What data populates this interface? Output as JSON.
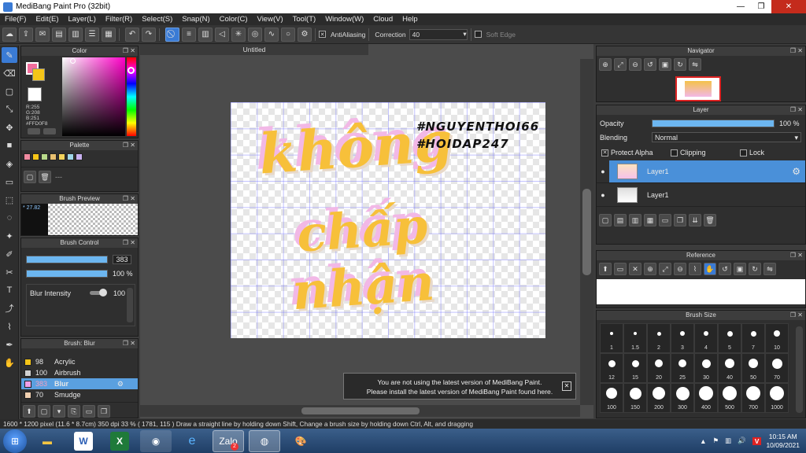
{
  "window": {
    "title": "MediBang Paint Pro (32bit)",
    "min": "—",
    "max": "❐",
    "close": "✕"
  },
  "menu": [
    "File(F)",
    "Edit(E)",
    "Layer(L)",
    "Filter(R)",
    "Select(S)",
    "Snap(N)",
    "Color(C)",
    "View(V)",
    "Tool(T)",
    "Window(W)",
    "Cloud",
    "Help"
  ],
  "toolbar": {
    "antialias_label": "AntiAliasing",
    "antialias_checked": "✕",
    "correction_label": "Correction",
    "correction_value": "40",
    "softedge_label": "Soft Edge"
  },
  "doc": {
    "tab_title": "Untitled"
  },
  "color_panel": {
    "title": "Color",
    "r": "R:255",
    "g": "G:208",
    "b": "B:251",
    "hex": "#FFD0F8",
    "fg": "#f0a0e8",
    "bg": "#f5c518"
  },
  "palette": {
    "title": "Palette",
    "swatches": [
      "#f08aa0",
      "#f5c518",
      "#b8d98a",
      "#e8c070",
      "#f2d35c",
      "#9ed6e8",
      "#c8b0f0"
    ],
    "dashes": "---"
  },
  "brush_preview": {
    "title": "Brush Preview",
    "size": "* 27.82"
  },
  "brush_control": {
    "title": "Brush Control",
    "size_value": "383",
    "opacity_value": "100 %",
    "blur_label": "Blur Intensity",
    "blur_value": "100",
    "size_fill": 1.0,
    "opacity_fill": 1.0,
    "blur_fill": 0.85
  },
  "brush_list": {
    "title": "Brush: Blur",
    "items": [
      {
        "size": "98",
        "name": "Acrylic",
        "color": "#f5c518",
        "selected": false
      },
      {
        "size": "100",
        "name": "Airbrush",
        "color": "#d0d0d0",
        "selected": false
      },
      {
        "size": "383",
        "name": "Blur",
        "color": "#f0a0e8",
        "selected": true
      },
      {
        "size": "70",
        "name": "Smudge",
        "color": "#f0d0b0",
        "selected": false
      }
    ]
  },
  "canvas": {
    "line1": "không",
    "line2": "chấp",
    "line3": "nhận",
    "tag1": "#NGUYENTHOI66",
    "tag2": "#HOIDAP247"
  },
  "notice": {
    "line1": "You are not using the latest version of MediBang Paint.",
    "line2": "Please install the latest version of MediBang Paint found here."
  },
  "navigator": {
    "title": "Navigator"
  },
  "layer_panel": {
    "title": "Layer",
    "opacity_label": "Opacity",
    "opacity_value": "100 %",
    "opacity_fill": 1.0,
    "blend_label": "Blending",
    "blend_value": "Normal",
    "protect_alpha": "Protect Alpha",
    "clipping": "Clipping",
    "lock": "Lock",
    "layers": [
      {
        "name": "Layer1",
        "selected": true
      },
      {
        "name": "Layer1",
        "selected": false
      }
    ]
  },
  "reference": {
    "title": "Reference"
  },
  "brush_size": {
    "title": "Brush Size",
    "sizes": [
      "1",
      "1.5",
      "2",
      "3",
      "4",
      "5",
      "7",
      "10",
      "12",
      "15",
      "20",
      "25",
      "30",
      "40",
      "50",
      "70",
      "100",
      "150",
      "200",
      "300",
      "400",
      "500",
      "700",
      "1000"
    ]
  },
  "status": {
    "text": "1600 * 1200 pixel   (11.6 * 8.7cm)   350 dpi   33 %   ( 1781, 115 )   Draw a straight line by holding down Shift, Change a brush size by holding down Ctrl, Alt, and dragging"
  },
  "taskbar": {
    "time": "10:15 AM",
    "date": "10/09/2021",
    "zalo_badge": "2"
  }
}
